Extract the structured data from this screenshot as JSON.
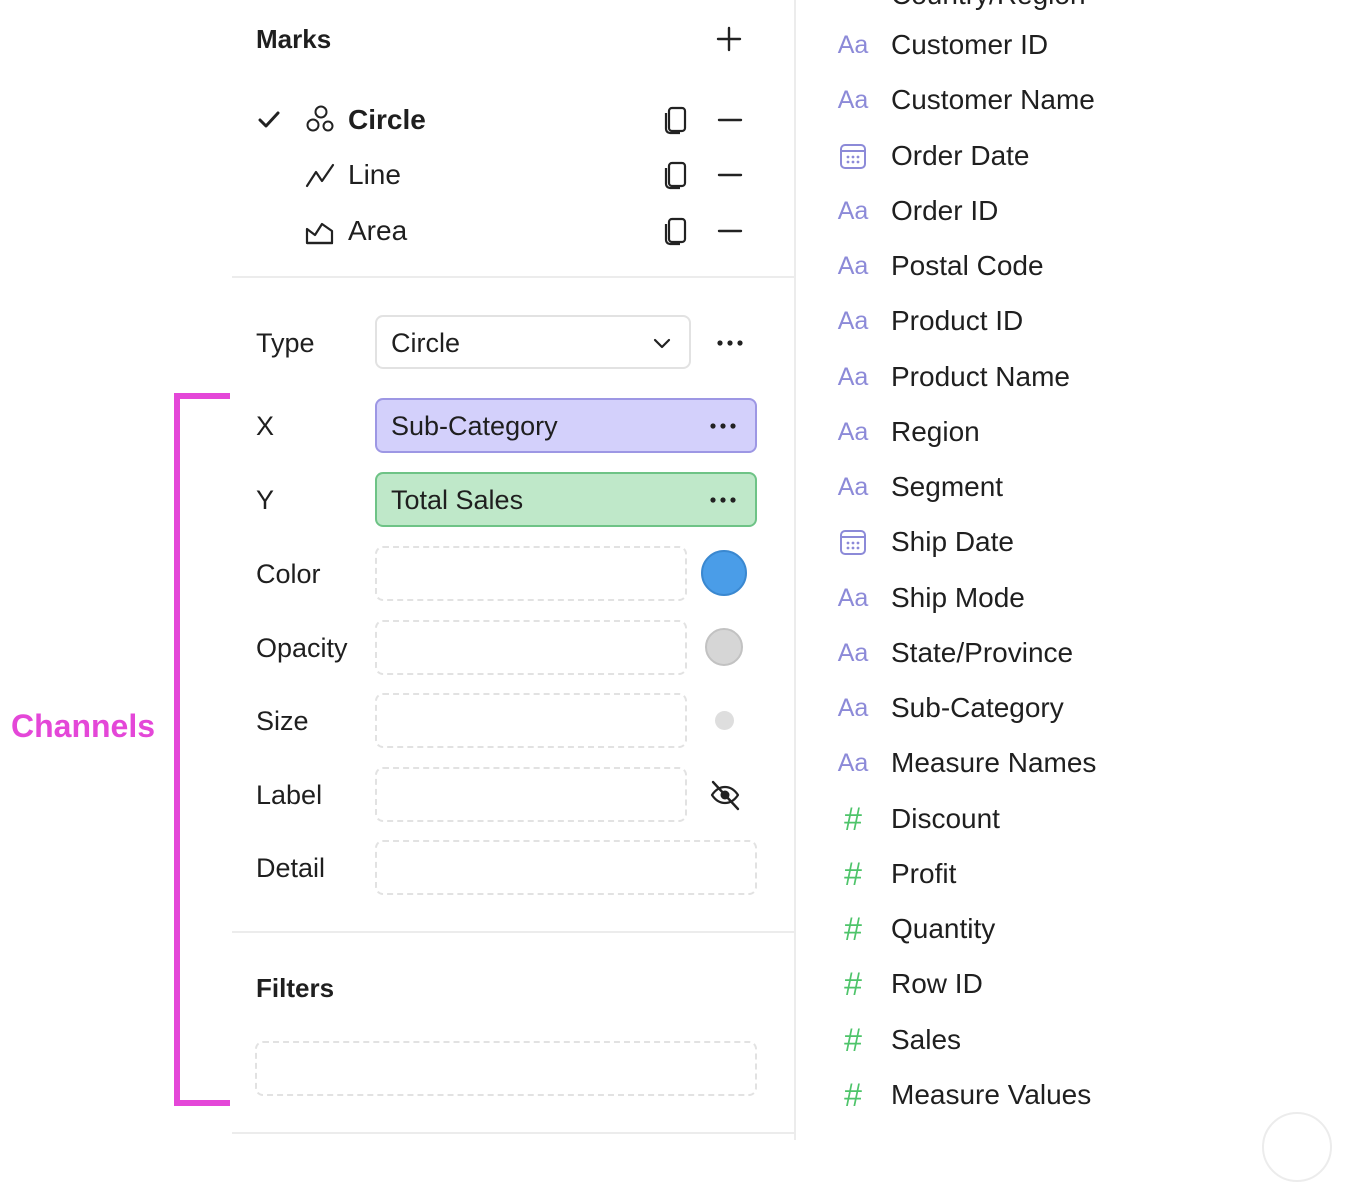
{
  "annotation": {
    "label": "Channels",
    "color": "#e447d8"
  },
  "marks": {
    "title": "Marks",
    "add_icon": "plus-icon",
    "items": [
      {
        "label": "Circle",
        "icon": "circle-mark-icon",
        "selected": true
      },
      {
        "label": "Line",
        "icon": "line-mark-icon",
        "selected": false
      },
      {
        "label": "Area",
        "icon": "area-mark-icon",
        "selected": false
      }
    ]
  },
  "properties": {
    "type": {
      "label": "Type",
      "value": "Circle"
    },
    "x": {
      "label": "X",
      "value": "Sub-Category",
      "color": "#d3d0fb"
    },
    "y": {
      "label": "Y",
      "value": "Total Sales",
      "color": "#bfe8c9"
    },
    "color": {
      "label": "Color",
      "swatch": "#4a9de8"
    },
    "opacity": {
      "label": "Opacity",
      "swatch": "#d6d6d6"
    },
    "size": {
      "label": "Size"
    },
    "label": {
      "label": "Label",
      "icon": "eye-off-icon"
    },
    "detail": {
      "label": "Detail"
    }
  },
  "filters": {
    "title": "Filters"
  },
  "fields": {
    "partial_top": "Country/Region",
    "items": [
      {
        "name": "Customer ID",
        "type": "text"
      },
      {
        "name": "Customer Name",
        "type": "text"
      },
      {
        "name": "Order Date",
        "type": "date"
      },
      {
        "name": "Order ID",
        "type": "text"
      },
      {
        "name": "Postal Code",
        "type": "text"
      },
      {
        "name": "Product ID",
        "type": "text"
      },
      {
        "name": "Product Name",
        "type": "text"
      },
      {
        "name": "Region",
        "type": "text"
      },
      {
        "name": "Segment",
        "type": "text"
      },
      {
        "name": "Ship Date",
        "type": "date"
      },
      {
        "name": "Ship Mode",
        "type": "text"
      },
      {
        "name": "State/Province",
        "type": "text"
      },
      {
        "name": "Sub-Category",
        "type": "text"
      },
      {
        "name": "Measure Names",
        "type": "text"
      },
      {
        "name": "Discount",
        "type": "number"
      },
      {
        "name": "Profit",
        "type": "number"
      },
      {
        "name": "Quantity",
        "type": "number"
      },
      {
        "name": "Row ID",
        "type": "number"
      },
      {
        "name": "Sales",
        "type": "number"
      },
      {
        "name": "Measure Values",
        "type": "number"
      }
    ],
    "text_icon_glyph": "Aa",
    "number_icon_glyph": "#"
  }
}
